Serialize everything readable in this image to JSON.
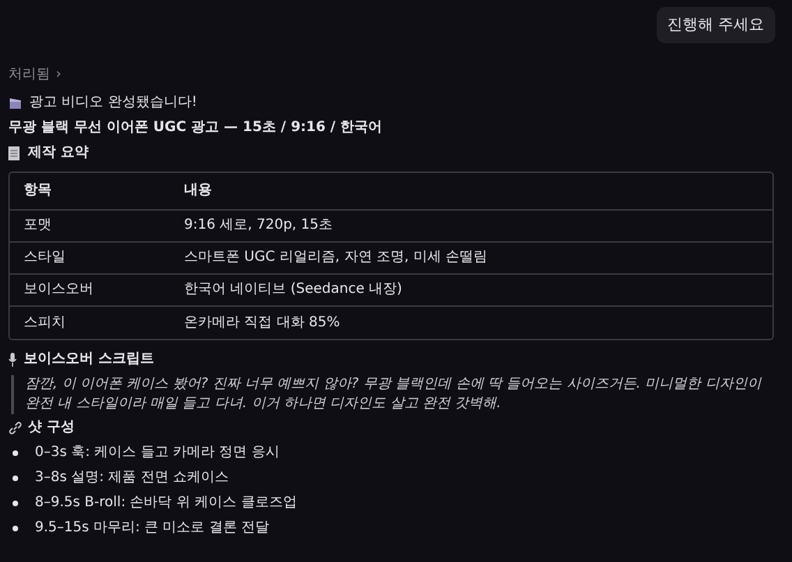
{
  "user_message": "진행해 주세요",
  "status": {
    "label": "처리됨",
    "chevron": "›"
  },
  "announcement": "광고 비디오 완성됐습니다!",
  "title": "무광 블랙 무선 이어폰 UGC 광고 — 15초 / 9:16 / 한국어",
  "summary": {
    "heading": "제작 요약",
    "table": {
      "columns": [
        "항목",
        "내용"
      ],
      "rows": [
        [
          "포맷",
          "9:16 세로, 720p, 15초"
        ],
        [
          "스타일",
          "스마트폰 UGC 리얼리즘, 자연 조명, 미세 손떨림"
        ],
        [
          "보이스오버",
          "한국어 네이티브 (Seedance 내장)"
        ],
        [
          "스피치",
          "온카메라 직접 대화 85%"
        ]
      ]
    }
  },
  "script": {
    "heading": "보이스오버 스크립트",
    "quote": "잠깐, 이 이어폰 케이스 봤어? 진짜 너무 예쁘지 않아? 무광 블랙인데 손에 딱 들어오는 사이즈거든. 미니멀한 디자인이 완전 내 스타일이라 매일 들고 다녀. 이거 하나면 디자인도 살고 완전 갓벽해."
  },
  "shots": {
    "heading": "샷 구성",
    "items": [
      "0–3s 훅: 케이스 들고 카메라 정면 응시",
      "3–8s 설명: 제품 전면 쇼케이스",
      "8–9.5s B-roll: 손바닥 위 케이스 클로즈업",
      "9.5–15s 마무리: 큰 미소로 결론 전달"
    ]
  }
}
